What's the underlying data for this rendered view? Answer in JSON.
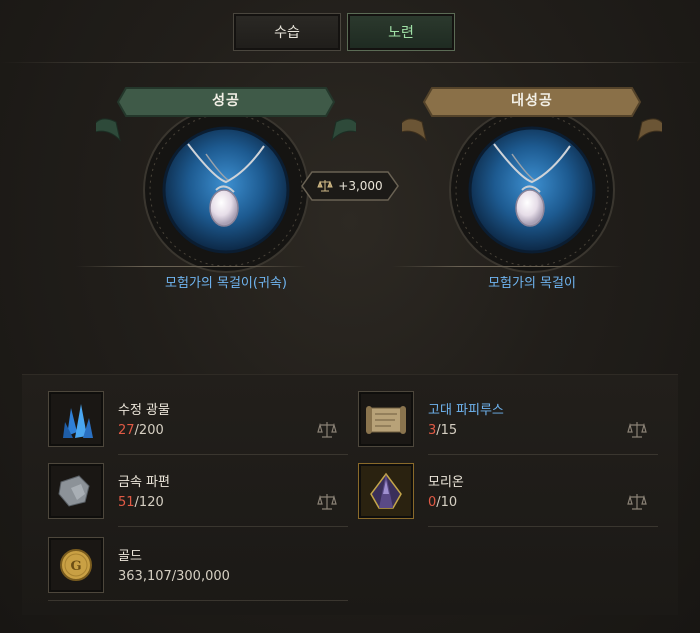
{
  "tabs": [
    {
      "label": "수습",
      "active": false
    },
    {
      "label": "노련",
      "active": true
    }
  ],
  "outcomes": {
    "success": {
      "banner": "성공",
      "item": "모험가의 목걸이(귀속)",
      "banner_color": "#3f5a48"
    },
    "great_success": {
      "banner": "대성공",
      "item": "모험가의 목걸이",
      "banner_color": "#8a7048"
    }
  },
  "bonus": {
    "label": "+3,000",
    "icon": "scale-icon"
  },
  "materials": [
    {
      "name": "수정 광물",
      "have": "27",
      "need": "/200",
      "rare": false,
      "icon": "crystal-ore-icon"
    },
    {
      "name": "고대 파피루스",
      "have": "3",
      "need": "/15",
      "rare": true,
      "icon": "papyrus-scroll-icon"
    },
    {
      "name": "금속 파편",
      "have": "51",
      "need": "/120",
      "rare": false,
      "icon": "metal-fragment-icon"
    },
    {
      "name": "모리온",
      "have": "0",
      "need": "/10",
      "rare": false,
      "icon": "morion-gem-icon"
    },
    {
      "name": "골드",
      "have": "",
      "need": "363,107/300,000",
      "rare": false,
      "icon": "gold-coin-icon"
    }
  ],
  "colors": {
    "have_deficit": "#e05a45",
    "rare_name": "#6fb4f0",
    "active_tab": "#9fe0a6"
  }
}
